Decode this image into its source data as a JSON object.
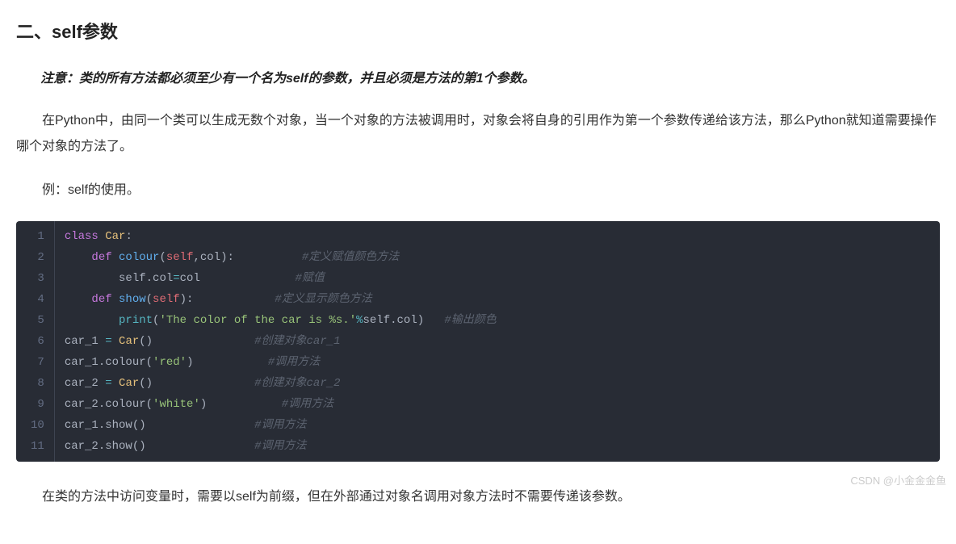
{
  "section_title": "二、self参数",
  "note": "注意：类的所有方法都必须至少有一个名为self的参数，并且必须是方法的第1个参数。",
  "paragraph1": "在Python中，由同一个类可以生成无数个对象，当一个对象的方法被调用时，对象会将自身的引用作为第一个参数传递给该方法，那么Python就知道需要操作哪个对象的方法了。",
  "paragraph2": "例：self的使用。",
  "paragraph3": "在类的方法中访问变量时，需要以self为前缀，但在外部通过对象名调用对象方法时不需要传递该参数。",
  "code": {
    "lines": [
      {
        "n": "1",
        "tokens": [
          {
            "t": "class ",
            "c": "tok-keyword"
          },
          {
            "t": "Car",
            "c": "tok-name"
          },
          {
            "t": ":",
            "c": "tok-punct"
          }
        ]
      },
      {
        "n": "2",
        "tokens": [
          {
            "t": "    ",
            "c": ""
          },
          {
            "t": "def ",
            "c": "tok-keyword"
          },
          {
            "t": "colour",
            "c": "tok-func"
          },
          {
            "t": "(",
            "c": "tok-punct"
          },
          {
            "t": "self",
            "c": "tok-self"
          },
          {
            "t": ",col):",
            "c": "tok-punct"
          },
          {
            "t": "          ",
            "c": ""
          },
          {
            "t": "#定义赋值颜色方法",
            "c": "tok-comment"
          }
        ]
      },
      {
        "n": "3",
        "tokens": [
          {
            "t": "        self",
            "c": "tok-var"
          },
          {
            "t": ".col",
            "c": "tok-punct"
          },
          {
            "t": "=",
            "c": "tok-op"
          },
          {
            "t": "col",
            "c": "tok-var"
          },
          {
            "t": "              ",
            "c": ""
          },
          {
            "t": "#赋值",
            "c": "tok-comment"
          }
        ]
      },
      {
        "n": "4",
        "tokens": [
          {
            "t": "    ",
            "c": ""
          },
          {
            "t": "def ",
            "c": "tok-keyword"
          },
          {
            "t": "show",
            "c": "tok-func"
          },
          {
            "t": "(",
            "c": "tok-punct"
          },
          {
            "t": "self",
            "c": "tok-self"
          },
          {
            "t": "):",
            "c": "tok-punct"
          },
          {
            "t": "            ",
            "c": ""
          },
          {
            "t": "#定义显示颜色方法",
            "c": "tok-comment"
          }
        ]
      },
      {
        "n": "5",
        "tokens": [
          {
            "t": "        ",
            "c": ""
          },
          {
            "t": "print",
            "c": "tok-builtin"
          },
          {
            "t": "(",
            "c": "tok-punct"
          },
          {
            "t": "'The color of the car is %s.'",
            "c": "tok-string"
          },
          {
            "t": "%",
            "c": "tok-op"
          },
          {
            "t": "self",
            "c": "tok-var"
          },
          {
            "t": ".col)",
            "c": "tok-punct"
          },
          {
            "t": "   ",
            "c": ""
          },
          {
            "t": "#输出颜色",
            "c": "tok-comment"
          }
        ]
      },
      {
        "n": "6",
        "tokens": [
          {
            "t": "car_1 ",
            "c": "tok-var"
          },
          {
            "t": "= ",
            "c": "tok-op"
          },
          {
            "t": "Car",
            "c": "tok-name"
          },
          {
            "t": "()",
            "c": "tok-punct"
          },
          {
            "t": "               ",
            "c": ""
          },
          {
            "t": "#创建对象car_1",
            "c": "tok-comment"
          }
        ]
      },
      {
        "n": "7",
        "tokens": [
          {
            "t": "car_1",
            "c": "tok-var"
          },
          {
            "t": ".colour(",
            "c": "tok-punct"
          },
          {
            "t": "'red'",
            "c": "tok-string"
          },
          {
            "t": ")",
            "c": "tok-punct"
          },
          {
            "t": "           ",
            "c": ""
          },
          {
            "t": "#调用方法",
            "c": "tok-comment"
          }
        ]
      },
      {
        "n": "8",
        "tokens": [
          {
            "t": "car_2 ",
            "c": "tok-var"
          },
          {
            "t": "= ",
            "c": "tok-op"
          },
          {
            "t": "Car",
            "c": "tok-name"
          },
          {
            "t": "()",
            "c": "tok-punct"
          },
          {
            "t": "               ",
            "c": ""
          },
          {
            "t": "#创建对象car_2",
            "c": "tok-comment"
          }
        ]
      },
      {
        "n": "9",
        "tokens": [
          {
            "t": "car_2",
            "c": "tok-var"
          },
          {
            "t": ".colour(",
            "c": "tok-punct"
          },
          {
            "t": "'white'",
            "c": "tok-string"
          },
          {
            "t": ")",
            "c": "tok-punct"
          },
          {
            "t": "           ",
            "c": ""
          },
          {
            "t": "#调用方法",
            "c": "tok-comment"
          }
        ]
      },
      {
        "n": "10",
        "tokens": [
          {
            "t": "car_1",
            "c": "tok-var"
          },
          {
            "t": ".show()",
            "c": "tok-punct"
          },
          {
            "t": "                ",
            "c": ""
          },
          {
            "t": "#调用方法",
            "c": "tok-comment"
          }
        ]
      },
      {
        "n": "11",
        "tokens": [
          {
            "t": "car_2",
            "c": "tok-var"
          },
          {
            "t": ".show()",
            "c": "tok-punct"
          },
          {
            "t": "                ",
            "c": ""
          },
          {
            "t": "#调用方法",
            "c": "tok-comment"
          }
        ]
      }
    ]
  },
  "watermark": "CSDN @小金金金鱼"
}
